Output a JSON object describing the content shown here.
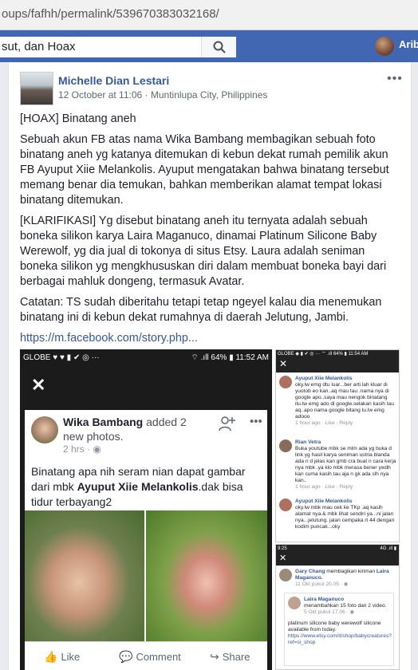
{
  "browser": {
    "url": "oups/fafhh/permalink/539670383032168/"
  },
  "fb_header": {
    "search_value": "sut, dan Hoax",
    "user_name": "Arib"
  },
  "post": {
    "author": "Michelle Dian Lestari",
    "meta": "12 October at 11:06 · Muntinlupa City, Philippines",
    "menu": "•••",
    "paragraphs": [
      "[HOAX] Binatang aneh",
      "Sebuah akun FB atas nama Wika Bambang membagikan sebuah foto binatang aneh yg katanya ditemukan di kebun dekat rumah pemilik akun FB Ayuput Xiie Melankolis. Ayuput mengatakan bahwa binatang tersebut memang benar dia temukan, bahkan memberikan alamat tempat lokasi binatang ditemukan.",
      "[KLARIFIKASI] Yg disebut binatang aneh itu ternyata adalah sebuah boneka silikon karya Laira Maganuco, dinamai Platinum Silicone Baby Werewolf, yg dia jual di tokonya di situs Etsy. Laura adalah seniman boneka silikon yg mengkhususkan diri dalam membuat boneka bayi dari berbagai mahluk dongeng, termasuk Avatar.",
      "Catatan: TS sudah diberitahu tetapi tetap ngeyel kalau dia menemukan binatang ini di kebun dekat rumahnya di daerah Jelutung, Jambi."
    ],
    "link": "https://m.facebook.com/story.php..."
  },
  "screenshot_left": {
    "status_left": "GLOBE ♥ ♥ ▮ ✔ ◎ ···",
    "status_right": "⌔ .ıll 64% ▮ 11:52 AM",
    "close": "✕",
    "poster": "Wika Bambang",
    "action": "added 2 new photos.",
    "time": "2 hrs · ◉",
    "menu": "•••",
    "text_plain": "Binatang apa nih seram nian dapat gambar dari mbk ",
    "text_bold": "Ayuput Xiie Melankolis",
    "text_end": ".dak bisa tidur terbayang2",
    "like": "Like",
    "comment": "Comment",
    "share": "Share"
  },
  "screenshot_right_top": {
    "status": "GLOBE ◆ ▮ ✔ ◎ ···    ⌔ .ıll 64% ▮ 11:54 AM",
    "close": "✕",
    "comments": [
      {
        "name": "Ayuput Xiie Melankolis",
        "text": "oky.lw emg dtu luar...ber arti lah kluar di yuotob eo kan..aq mau tau .nama nya di google apo..saya mau nengok binatang itu.lw emg ado di google.selakan kasih tau aq..apo nama google bitang tu.lw emg adooo",
        "meta": "1 hour ago · Like · Reply"
      },
      {
        "name": "Rian Vetra",
        "text": "Buka youtube mbk se mlm ada yg buka d link yg hasil karya seniman ustria blanda ada n d jelas kan gmb cra buat n cara kerja nya mbk .ya klo mbk merasa bener ywdh kan cuma kasih tau aja n gk ada slh nya kan..",
        "meta": "1 hour ago · Like · Reply"
      },
      {
        "name": "Ayuput Xiie Melankolis",
        "text": "oky.lw mbk mau cek ke TKp .aq kasih alamat nya.& mbk lihat sendiri ya...ni jalan nya...jelutung. jalan cempaka rt 44 dengan kodim puncak...oky",
        "meta": ""
      }
    ]
  },
  "screenshot_right_bottom": {
    "status_left": "9:25",
    "status_right": "4G .ıll ▮",
    "close": "✕",
    "sharer": "Gary Chang",
    "share_action": "membagikan kiriman",
    "share_target": "Laira Maganuco.",
    "share_time": "11 Okt pukul 20.05 · ◉",
    "inner_name": "Laira Maganuco",
    "inner_action": "menambahkan 15 foto dan 2 video.",
    "inner_time": "5 Okt pukul 17.06 · ◉",
    "inner_text": "platinum silicone baby  werewolf silicone available from today.",
    "inner_link": "https://www.etsy.com/it/shop/babycreatures?ref=si_shop"
  }
}
